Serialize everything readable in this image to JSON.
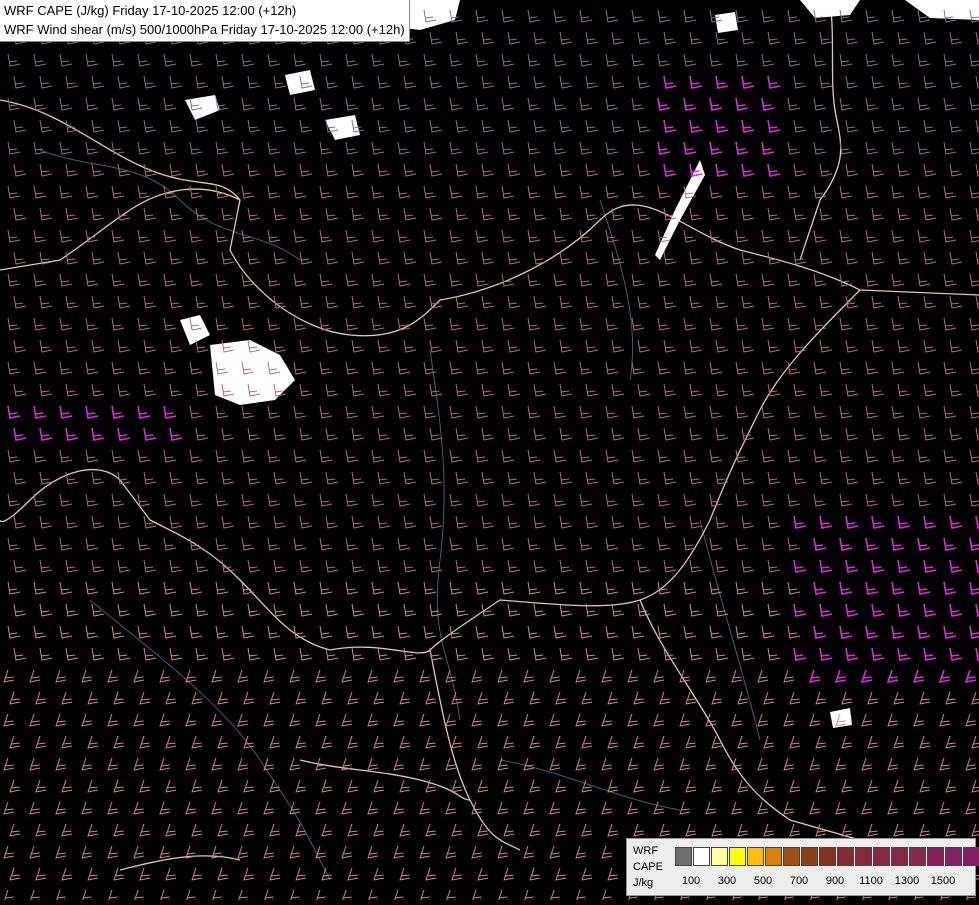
{
  "titles": {
    "line1": "WRF CAPE (J/kg) Friday 17-10-2025 12:00 (+12h)",
    "line2": "WRF Wind shear (m/s) 500/1000hPa Friday 17-10-2025 12:00 (+12h)"
  },
  "legend": {
    "label_model": "WRF",
    "label_field": "CAPE",
    "label_unit": "J/kg",
    "colors": [
      "#6e6e6e",
      "#ffffff",
      "#ffffa0",
      "#ffff00",
      "#ffc000",
      "#e08000",
      "#a05010",
      "#904018",
      "#883020",
      "#882830",
      "#882838",
      "#882840",
      "#882848",
      "#882850",
      "#882058",
      "#882060",
      "#881868",
      "#881070"
    ],
    "tick_labels": [
      "100",
      "300",
      "500",
      "700",
      "900",
      "1100",
      "1300",
      "1500"
    ]
  },
  "colors": {
    "background": "#000000",
    "barb_low": "#8a6f86",
    "barb_mid": "#b06f78",
    "barb_high": "#d08a8a",
    "barb_strong": "#d52fd5",
    "border": "#e8c9a0",
    "river": "#4a5a78",
    "cape_patch": "#ffffff"
  }
}
